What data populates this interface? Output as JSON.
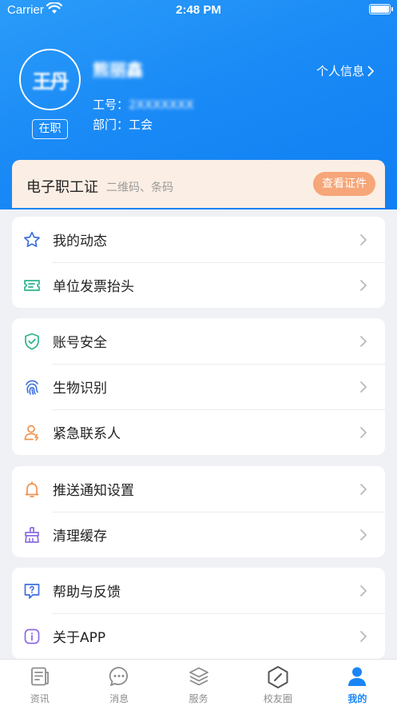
{
  "status_bar": {
    "carrier": "Carrier",
    "time": "2:48 PM"
  },
  "profile": {
    "avatar_text": "王丹",
    "name": "熊丽鑫",
    "status": "在职",
    "employee_id_label": "工号：",
    "employee_id_value": "2XXXXXXX",
    "department_label": "部门：",
    "department_value": "工会",
    "profile_link": "个人信息"
  },
  "id_card": {
    "title": "电子职工证",
    "subtitle": "二维码、条码",
    "button": "查看证件"
  },
  "menu_groups": [
    {
      "items": [
        {
          "label": "我的动态",
          "icon": "star-icon",
          "color": "#3d6fe0"
        },
        {
          "label": "单位发票抬头",
          "icon": "ticket-icon",
          "color": "#2bb58c"
        }
      ]
    },
    {
      "items": [
        {
          "label": "账号安全",
          "icon": "shield-check-icon",
          "color": "#2bb58c"
        },
        {
          "label": "生物识别",
          "icon": "fingerprint-icon",
          "color": "#3d6fe0"
        },
        {
          "label": "紧急联系人",
          "icon": "emergency-contact-icon",
          "color": "#f0914f"
        }
      ]
    },
    {
      "items": [
        {
          "label": "推送通知设置",
          "icon": "bell-icon",
          "color": "#f0914f"
        },
        {
          "label": "清理缓存",
          "icon": "broom-icon",
          "color": "#8c6ce0"
        }
      ]
    },
    {
      "items": [
        {
          "label": "帮助与反馈",
          "icon": "help-icon",
          "color": "#3d6fe0"
        },
        {
          "label": "关于APP",
          "icon": "info-icon",
          "color": "#8c6ce0"
        }
      ]
    }
  ],
  "tabbar": {
    "tabs": [
      {
        "label": "资讯",
        "icon": "news-icon"
      },
      {
        "label": "消息",
        "icon": "message-icon"
      },
      {
        "label": "服务",
        "icon": "layers-icon"
      },
      {
        "label": "校友圈",
        "icon": "alumni-icon"
      },
      {
        "label": "我的",
        "icon": "person-icon",
        "active": true
      }
    ]
  },
  "colors": {
    "primary": "#1a86f6",
    "accent_orange": "#f6a678",
    "id_card_bg": "#fbeee4"
  }
}
